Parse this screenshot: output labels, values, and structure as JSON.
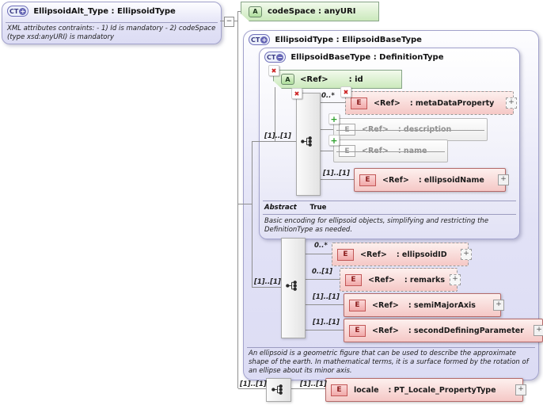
{
  "icons": {
    "complex_type": "CT",
    "attribute": "A",
    "element": "E",
    "expand": "+",
    "collapse": "−",
    "removed_badge": "✖",
    "added_badge": "+"
  },
  "left_box": {
    "title": "EllipsoidAlt_Type : EllipsoidType",
    "annotation": "XML attributes contraints: - 1) Id is mandatory - 2) codeSpace (type xsd:anyURI) is mandatory"
  },
  "codespace_attribute": {
    "label": "codeSpace : anyURI"
  },
  "ellipsoid_type": {
    "title": "EllipsoidType : EllipsoidBaseType",
    "annotation": "An ellipsoid is a geometric figure that can be used to describe the approximate shape of the earth. In mathematical terms, it is a surface formed by the rotation of an ellipse about its minor axis.",
    "base": {
      "title": "EllipsoidBaseType : DefinitionType",
      "id_attribute": {
        "ref": "<Ref>",
        "name": ": id"
      },
      "sequence_cardinality": "[1]..[1]",
      "elements": [
        {
          "cardinality": "0..*",
          "ref": "<Ref>",
          "name": ": metaDataProperty"
        },
        {
          "cardinality": "",
          "ref": "<Ref>",
          "name": ": description"
        },
        {
          "cardinality": "",
          "ref": "<Ref>",
          "name": ": name"
        },
        {
          "cardinality": "[1]..[1]",
          "ref": "<Ref>",
          "name": ": ellipsoidName"
        }
      ],
      "abstract_label": "Abstract",
      "abstract_value": "True",
      "annotation": "Basic encoding for ellipsoid objects, simplifying and restricting the DefinitionType as needed."
    },
    "extension": {
      "sequence_cardinality": "[1]..[1]",
      "elements": [
        {
          "cardinality": "0..*",
          "ref": "<Ref>",
          "name": ": ellipsoidID"
        },
        {
          "cardinality": "0..[1]",
          "ref": "<Ref>",
          "name": ": remarks"
        },
        {
          "cardinality": "[1]..[1]",
          "ref": "<Ref>",
          "name": ": semiMajorAxis"
        },
        {
          "cardinality": "[1]..[1]",
          "ref": "<Ref>",
          "name": ": secondDefiningParameter"
        }
      ]
    }
  },
  "locale_row": {
    "sequence_cardinality": "[1]..[1]",
    "element_cardinality": "[1]..[1]",
    "name": "locale",
    "type": ": PT_Locale_PropertyType"
  },
  "colors": {
    "lavender_fill": "#dedef5",
    "pink_fill": "#f5c8c6",
    "green_fill": "#cbe9bc",
    "disabled_text": "#8f8f8f",
    "badge_red": "#cc2222",
    "badge_green": "#2ea02e",
    "connector": "#8f8f8f"
  }
}
